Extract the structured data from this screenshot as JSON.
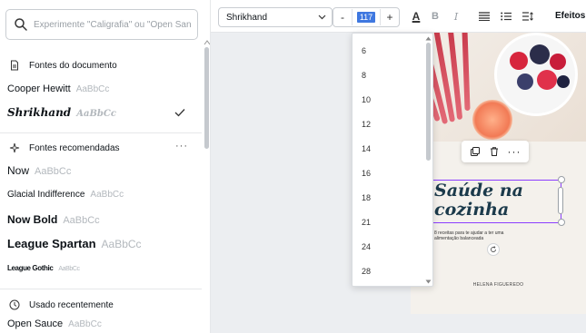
{
  "font_panel": {
    "search_placeholder": "Experimente \"Caligrafia\" ou \"Open San",
    "document_fonts": {
      "heading": "Fontes do documento",
      "items": [
        {
          "name": "Cooper Hewitt",
          "sample": "AaBbCc",
          "selected": false
        },
        {
          "name": "Shrikhand",
          "sample": "AaBbCc",
          "selected": true
        }
      ]
    },
    "recommended_fonts": {
      "heading": "Fontes recomendadas",
      "more": "···",
      "items": [
        {
          "name": "Now",
          "sample": "AaBbCc"
        },
        {
          "name": "Glacial Indifference",
          "sample": "AaBbCc"
        },
        {
          "name": "Now Bold",
          "sample": "AaBbCc"
        },
        {
          "name": "League Spartan",
          "sample": "AaBbCc"
        },
        {
          "name": "League Gothic",
          "sample": "AaBbCc"
        }
      ]
    },
    "recent_fonts": {
      "heading": "Usado recentemente",
      "items": [
        {
          "name": "Open Sauce",
          "sample": "AaBbCc"
        }
      ]
    }
  },
  "toolbar": {
    "font_name": "Shrikhand",
    "decrease": "-",
    "increase": "+",
    "font_size": "117",
    "text_color_icon": "A",
    "bold": "B",
    "italic": "I",
    "effects_label": "Efeitos",
    "accent_color": "#3f78e0"
  },
  "size_dropdown": {
    "options": [
      "6",
      "8",
      "10",
      "12",
      "14",
      "16",
      "18",
      "21",
      "24",
      "28"
    ]
  },
  "design": {
    "title_line1": "Saúde na",
    "title_line2": "cozinha",
    "subtitle": "8 receitas para te ajudar a ter uma alimentação balanceada",
    "author": "HELENA FIGUEREDO",
    "selection_color": "#8b3dff",
    "title_color": "#1b3a4b"
  }
}
